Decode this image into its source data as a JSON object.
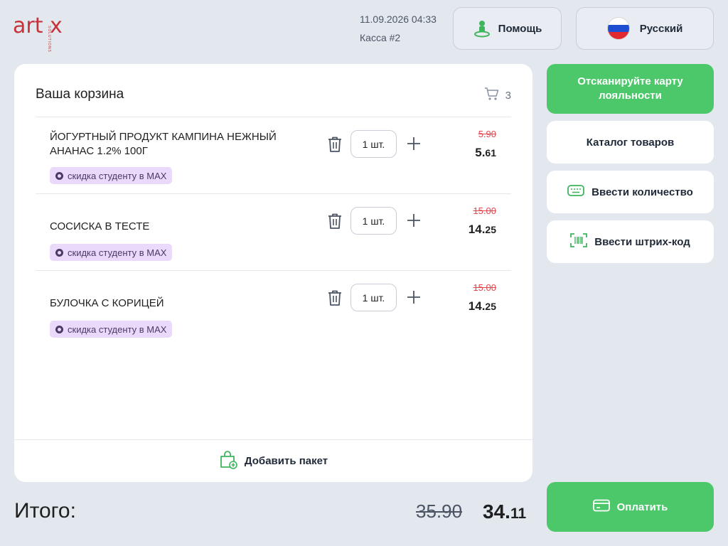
{
  "header": {
    "logo_text": "art x",
    "logo_sub": "SOLUTIONS",
    "datetime": "11.09.2026 04:33",
    "register": "Касса #2",
    "help_label": "Помощь",
    "language_label": "Русский"
  },
  "cart": {
    "title": "Ваша корзина",
    "count": "3",
    "items": [
      {
        "name": "ЙОГУРТНЫЙ ПРОДУКТ КАМПИНА НЕЖНЫЙ АНАНАС 1.2% 100Г",
        "qty": "1 шт.",
        "old_price": "5.90",
        "price_int": "5.",
        "price_cents": "61",
        "badge": "скидка студенту в MAX"
      },
      {
        "name": "СОСИСКА В ТЕСТЕ",
        "qty": "1 шт.",
        "old_price": "15.00",
        "price_int": "14.",
        "price_cents": "25",
        "badge": "скидка студенту в MAX"
      },
      {
        "name": "БУЛОЧКА С КОРИЦЕЙ",
        "qty": "1 шт.",
        "old_price": "15.00",
        "price_int": "14.",
        "price_cents": "25",
        "badge": "скидка студенту в MAX"
      }
    ],
    "add_bag_label": "Добавить пакет"
  },
  "side": {
    "loyalty_label": "Отсканируйте карту лояльности",
    "catalog_label": "Каталог товаров",
    "enter_qty_label": "Ввести количество",
    "enter_barcode_label": "Ввести штрих-код",
    "pay_label": "Оплатить"
  },
  "total": {
    "label": "Итого:",
    "old": "35.90",
    "new_int": "34.",
    "new_cents": "11"
  },
  "colors": {
    "accent_green": "#4cc86a",
    "brand_red": "#c8323a",
    "strike_red": "#e0464b",
    "badge_bg": "#ead9fb",
    "background": "#e3e8ef"
  }
}
